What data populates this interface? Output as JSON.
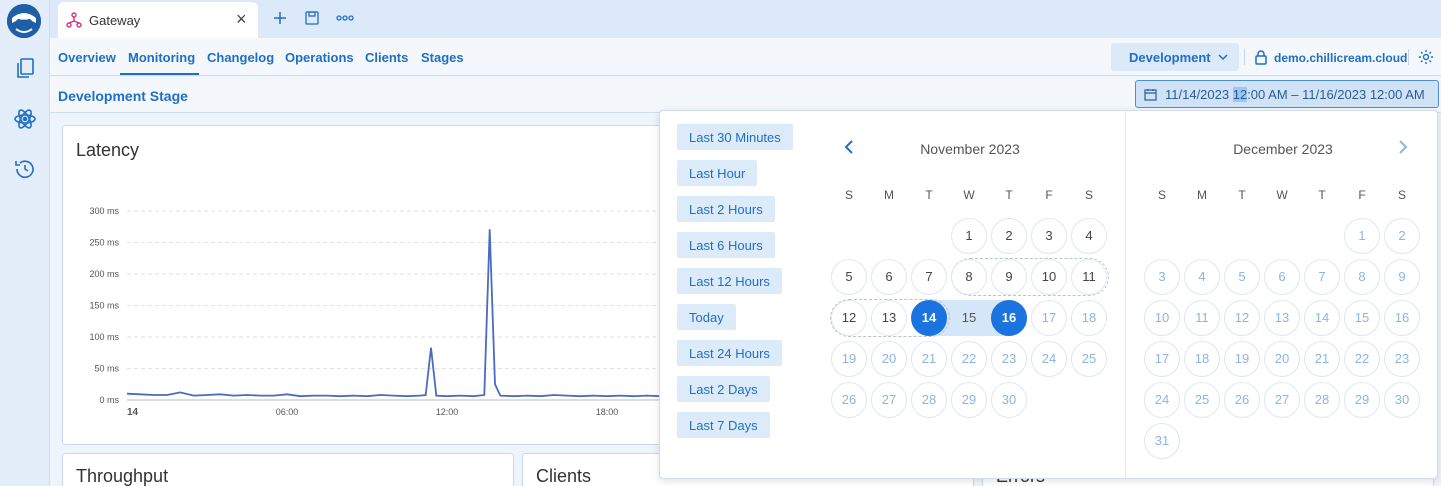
{
  "tab": {
    "title": "Gateway"
  },
  "nav": {
    "items": [
      "Overview",
      "Monitoring",
      "Changelog",
      "Operations",
      "Clients",
      "Stages"
    ],
    "active": "Monitoring",
    "environment": "Development",
    "host": "demo.chillicream.cloud"
  },
  "stage": {
    "title": "Development Stage",
    "date_range": {
      "before": "11/14/2023 ",
      "selected": "12",
      "after": ":00 AM – 11/16/2023 12:00 AM"
    }
  },
  "cards": {
    "latency": "Latency",
    "throughput": "Throughput",
    "clients": "Clients",
    "errors": "Errors"
  },
  "chart_data": {
    "type": "line",
    "title": "Latency",
    "y_ticks": [
      "300 ms",
      "250 ms",
      "200 ms",
      "150 ms",
      "100 ms",
      "50 ms",
      "0 ms"
    ],
    "y_tick_values": [
      300,
      250,
      200,
      150,
      100,
      50,
      0
    ],
    "ylim": [
      0,
      300
    ],
    "x_ticks": [
      "14",
      "06:00",
      "12:00",
      "18:00"
    ],
    "x_tick_hours": [
      0,
      6,
      12,
      18
    ],
    "series": [
      {
        "x": [
          0,
          0.5,
          1,
          1.5,
          2,
          2.5,
          3,
          3.5,
          4,
          4.5,
          5,
          5.5,
          6,
          6.5,
          7,
          7.5,
          8,
          8.5,
          9,
          9.5,
          10,
          10.5,
          11,
          11.2,
          11.4,
          11.6,
          12,
          12.5,
          13,
          13.4,
          13.6,
          13.8,
          14,
          14.5,
          15,
          15.5,
          16,
          16.5,
          17,
          17.5,
          18,
          18.5,
          19,
          19.5,
          20
        ],
        "y": [
          10,
          9,
          8,
          8,
          12,
          7,
          8,
          9,
          7,
          8,
          7,
          7,
          9,
          6,
          7,
          7,
          6,
          7,
          6,
          8,
          7,
          6,
          7,
          8,
          83,
          7,
          6,
          7,
          6,
          8,
          271,
          25,
          7,
          6,
          7,
          6,
          8,
          7,
          6,
          7,
          6,
          7,
          6,
          7,
          6
        ]
      }
    ]
  },
  "date_picker": {
    "presets": [
      "Last 30 Minutes",
      "Last Hour",
      "Last 2 Hours",
      "Last 6 Hours",
      "Last 12 Hours",
      "Today",
      "Last 24 Hours",
      "Last 2 Days",
      "Last 7 Days"
    ],
    "weekdays": [
      "S",
      "M",
      "T",
      "W",
      "T",
      "F",
      "S"
    ],
    "months": [
      {
        "title": "November 2023",
        "first_weekday": 3,
        "days": 30
      },
      {
        "title": "December 2023",
        "first_weekday": 5,
        "days": 31
      }
    ],
    "range_start": 14,
    "range_end": 16
  },
  "colors": {
    "accent": "#1f6fc5",
    "line": "#4a6bbf",
    "selected": "#1a73de"
  }
}
